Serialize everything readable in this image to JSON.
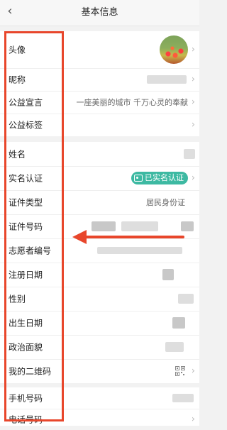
{
  "nav": {
    "title": "基本信息",
    "back_icon": "chevron-left-icon"
  },
  "profile": {
    "rows": [
      {
        "label": "头像",
        "value": "",
        "kind": "avatar"
      },
      {
        "label": "昵称",
        "value": "",
        "kind": "masked"
      },
      {
        "label": "公益宣言",
        "value": "一座美丽的城市 千万心灵的奉献",
        "kind": "text"
      },
      {
        "label": "公益标签",
        "value": "",
        "kind": "empty"
      }
    ]
  },
  "identity": {
    "rows": [
      {
        "label": "姓名",
        "value": ""
      },
      {
        "label": "实名认证",
        "value": "已实名认证"
      },
      {
        "label": "证件类型",
        "value": "居民身份证"
      },
      {
        "label": "证件号码",
        "value": ""
      },
      {
        "label": "志愿者编号",
        "value": ""
      },
      {
        "label": "注册日期",
        "value": ""
      },
      {
        "label": "性别",
        "value": ""
      },
      {
        "label": "出生日期",
        "value": ""
      },
      {
        "label": "政治面貌",
        "value": ""
      },
      {
        "label": "我的二维码",
        "value": ""
      }
    ]
  },
  "contact": {
    "rows": [
      {
        "label": "手机号码",
        "value": ""
      },
      {
        "label": "电话号码",
        "value": ""
      }
    ]
  },
  "annotation": {
    "color": "#e8462b"
  },
  "colors": {
    "verified_badge": "#3db9a2"
  }
}
